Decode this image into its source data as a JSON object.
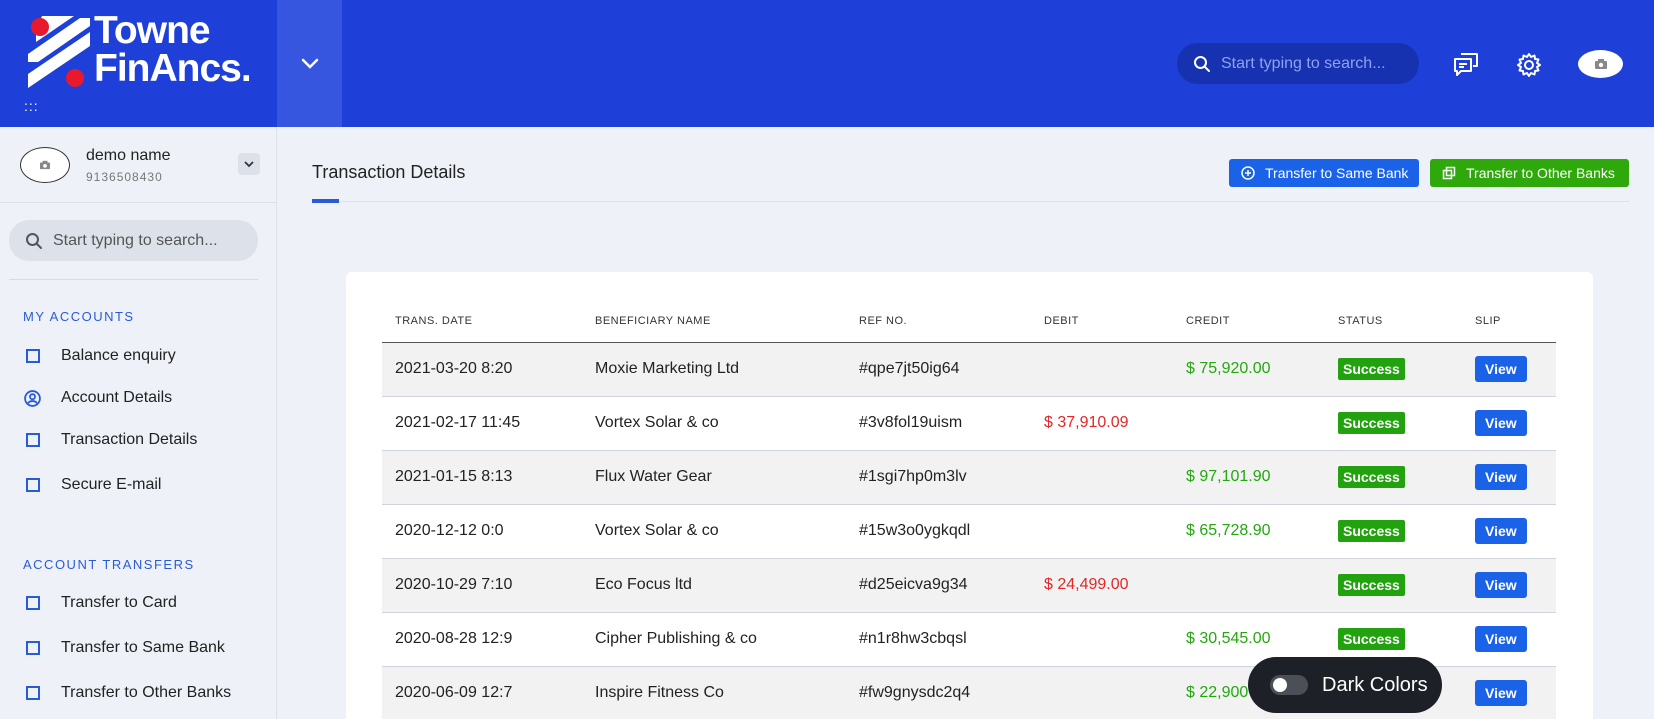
{
  "brand": {
    "line1": "Towne",
    "line2": "FinAncs.",
    "dots": ":::"
  },
  "header": {
    "search_placeholder": "Start typing to search..."
  },
  "profile": {
    "name": "demo name",
    "number": "9136508430"
  },
  "sidebar": {
    "search_placeholder": "Start typing to search...",
    "sections": [
      {
        "title": "MY ACCOUNTS",
        "items": [
          {
            "label": "Balance enquiry",
            "icon": "square-icon"
          },
          {
            "label": "Account Details",
            "icon": "user-circle-icon"
          },
          {
            "label": "Transaction Details",
            "icon": "square-icon"
          },
          {
            "label": "Secure E-mail",
            "icon": "square-icon"
          }
        ]
      },
      {
        "title": "ACCOUNT TRANSFERS",
        "items": [
          {
            "label": "Transfer to Card",
            "icon": "square-icon"
          },
          {
            "label": "Transfer to Same Bank",
            "icon": "square-icon"
          },
          {
            "label": "Transfer to Other Banks",
            "icon": "square-icon"
          }
        ]
      }
    ]
  },
  "main": {
    "title": "Transaction Details",
    "buttons": {
      "same_bank": "Transfer to Same Bank",
      "other_banks": "Transfer to Other Banks"
    },
    "table": {
      "headers": [
        "TRANS. DATE",
        "BENEFICIARY NAME",
        "REF NO.",
        "DEBIT",
        "CREDIT",
        "STATUS",
        "SLIP"
      ],
      "rows": [
        {
          "date": "2021-03-20 8:20",
          "name": "Moxie Marketing Ltd",
          "ref": "#qpe7jt50ig64",
          "debit": "",
          "credit": "$ 75,920.00",
          "status": "Success",
          "slip": "View"
        },
        {
          "date": "2021-02-17 11:45",
          "name": "Vortex Solar & co",
          "ref": "#3v8fol19uism",
          "debit": "$ 37,910.09",
          "credit": "",
          "status": "Success",
          "slip": "View"
        },
        {
          "date": "2021-01-15 8:13",
          "name": "Flux Water Gear",
          "ref": "#1sgi7hp0m3lv",
          "debit": "",
          "credit": "$ 97,101.90",
          "status": "Success",
          "slip": "View"
        },
        {
          "date": "2020-12-12 0:0",
          "name": "Vortex Solar & co",
          "ref": "#15w3o0ygkqdl",
          "debit": "",
          "credit": "$ 65,728.90",
          "status": "Success",
          "slip": "View"
        },
        {
          "date": "2020-10-29 7:10",
          "name": "Eco Focus ltd",
          "ref": "#d25eicva9g34",
          "debit": "$ 24,499.00",
          "credit": "",
          "status": "Success",
          "slip": "View"
        },
        {
          "date": "2020-08-28 12:9",
          "name": "Cipher Publishing & co",
          "ref": "#n1r8hw3cbqsl",
          "debit": "",
          "credit": "$ 30,545.00",
          "status": "Success",
          "slip": "View"
        },
        {
          "date": "2020-06-09 12:7",
          "name": "Inspire Fitness Co",
          "ref": "#fw9gnysdc2q4",
          "debit": "",
          "credit": "$ 22,900",
          "status": "",
          "slip": "View"
        }
      ]
    }
  },
  "dark_mode": {
    "label": "Dark Colors",
    "enabled": false
  },
  "colors": {
    "header": "#1e3fd8",
    "accent": "#1a62e8",
    "success": "#2fa80c",
    "debit": "#e32727",
    "credit": "#23a80e",
    "logo_dot": "#e8192c"
  }
}
